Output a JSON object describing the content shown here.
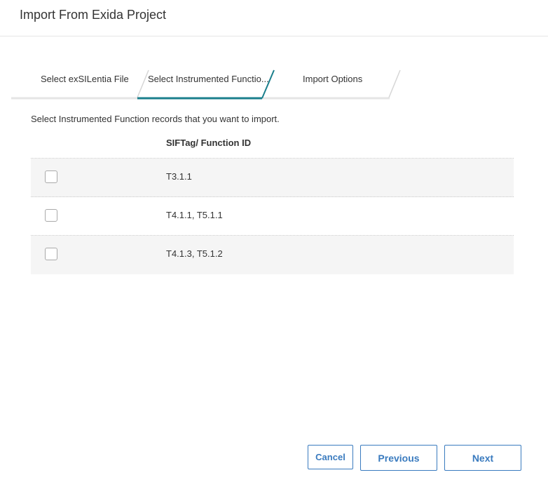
{
  "dialog": {
    "title": "Import From Exida Project"
  },
  "wizard": {
    "steps": [
      {
        "label": "Select exSILentia File",
        "active": false
      },
      {
        "label": "Select Instrumented Functio...",
        "active": true
      },
      {
        "label": "Import Options",
        "active": false
      }
    ],
    "active_color": "#1b7f8c"
  },
  "main": {
    "instruction": "Select Instrumented Function records that you want to import.",
    "grid": {
      "column_header": "SIFTag/ Function ID",
      "rows": [
        {
          "checked": false,
          "value": "T3.1.1"
        },
        {
          "checked": false,
          "value": "T4.1.1, T5.1.1"
        },
        {
          "checked": false,
          "value": "T4.1.3, T5.1.2"
        }
      ]
    }
  },
  "footer": {
    "cancel_label": "Cancel",
    "previous_label": "Previous",
    "next_label": "Next",
    "button_color": "#3a7bbf"
  }
}
